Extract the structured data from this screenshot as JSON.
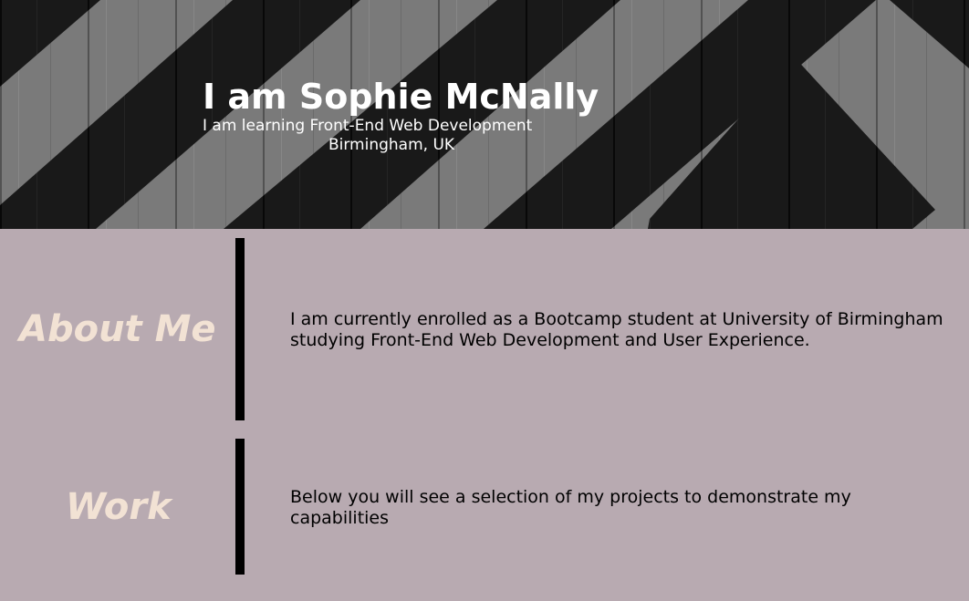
{
  "header": {
    "name": "I am Sophie McNally",
    "tagline": "I am learning Front-End Web Development",
    "location": "Birmingham, UK"
  },
  "sections": [
    {
      "title": "About Me",
      "body": "I am currently enrolled as a Bootcamp student at University of Birmingham studying Front-End Web Development and User Experience."
    },
    {
      "title": "Work",
      "body": "Below you will see a selection of my projects to demonstrate my capabilities"
    }
  ],
  "colors": {
    "hero_dark": "#2a2a2a",
    "hero_planks": "#8a8a8a",
    "main_background": "#b8aab1",
    "heading_cream": "#f2e2d4",
    "divider": "#000000",
    "body_text": "#000000",
    "hero_text": "#ffffff"
  }
}
